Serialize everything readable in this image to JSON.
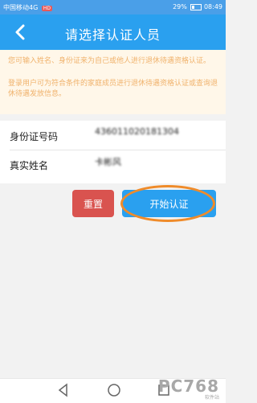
{
  "statusbar": {
    "carrier": "中国移动4G",
    "badge": "HD",
    "battery_percent": "29%",
    "battery_level": 0.29,
    "time": "08:49"
  },
  "header": {
    "title": "请选择认证人员"
  },
  "notice": {
    "line1": "您可输入姓名、身份证来为自己或他人进行退休待遇资格认证。",
    "line2": "登录用户可为符合条件的家庭成员进行退休待遇资格认证或查询退休待遇发放信息。"
  },
  "form": {
    "id_label": "身份证号码",
    "id_value": "436011020181304",
    "name_label": "真实姓名",
    "name_value": "卡彬风"
  },
  "buttons": {
    "reset": "重置",
    "start": "开始认证"
  },
  "watermark": {
    "logo": "PC768",
    "sub": "软件站"
  },
  "colors": {
    "accent": "#2aa0ef",
    "notice_text": "#f0b26c",
    "reset": "#d9534f",
    "highlight": "#ef8b2a"
  }
}
